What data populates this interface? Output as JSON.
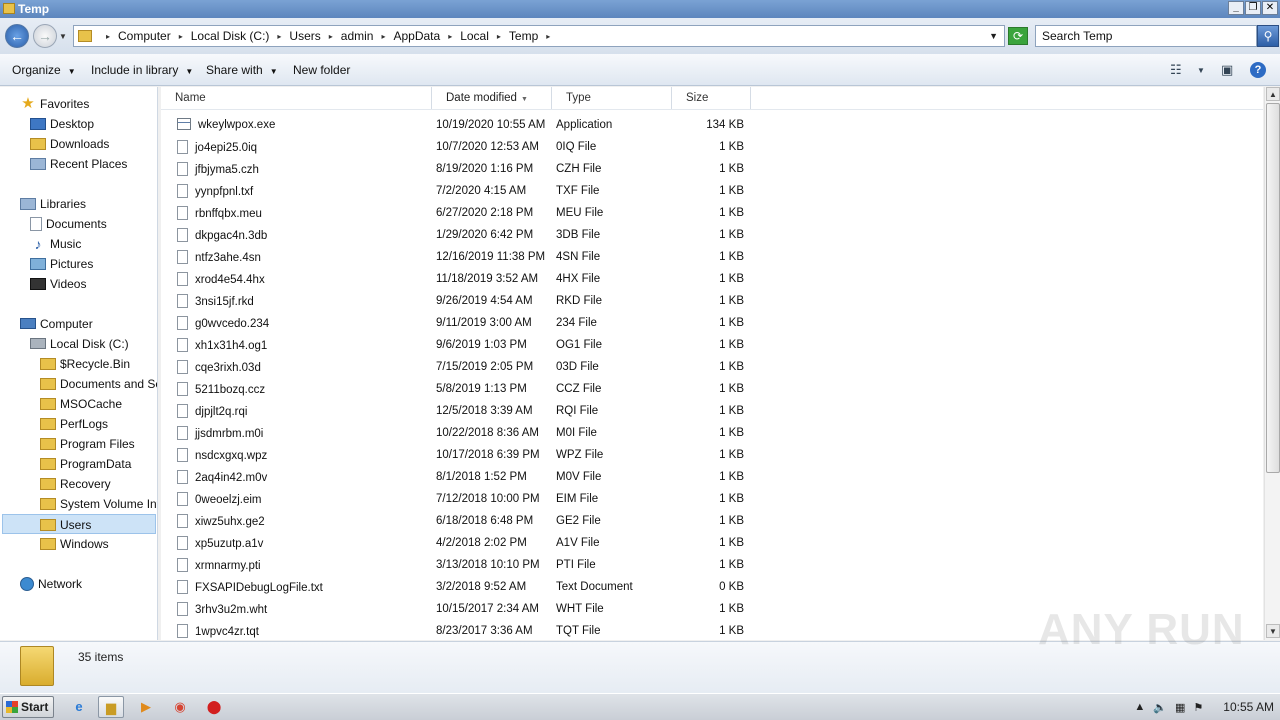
{
  "window": {
    "title": "Temp"
  },
  "address": {
    "crumbs": [
      "Computer",
      "Local Disk (C:)",
      "Users",
      "admin",
      "AppData",
      "Local",
      "Temp"
    ],
    "search_placeholder": "Search Temp"
  },
  "toolbar": {
    "organize": "Organize",
    "include_in_library": "Include in library",
    "share_with": "Share with",
    "new_folder": "New folder"
  },
  "sidebar": {
    "favorites": "Favorites",
    "desktop": "Desktop",
    "downloads": "Downloads",
    "recent_places": "Recent Places",
    "libraries": "Libraries",
    "documents": "Documents",
    "music": "Music",
    "pictures": "Pictures",
    "videos": "Videos",
    "computer": "Computer",
    "local_disk": "Local Disk (C:)",
    "folders": [
      "$Recycle.Bin",
      "Documents and Sett",
      "MSOCache",
      "PerfLogs",
      "Program Files",
      "ProgramData",
      "Recovery",
      "System Volume Infor",
      "Users",
      "Windows"
    ],
    "network": "Network"
  },
  "columns": {
    "name": "Name",
    "date": "Date modified",
    "type": "Type",
    "size": "Size"
  },
  "files": [
    {
      "name": "wkeylwpox.exe",
      "date": "10/19/2020 10:55 AM",
      "type": "Application",
      "size": "134 KB"
    },
    {
      "name": "jo4epi25.0iq",
      "date": "10/7/2020 12:53 AM",
      "type": "0IQ File",
      "size": "1 KB"
    },
    {
      "name": "jfbjyma5.czh",
      "date": "8/19/2020 1:16 PM",
      "type": "CZH File",
      "size": "1 KB"
    },
    {
      "name": "yynpfpnl.txf",
      "date": "7/2/2020 4:15 AM",
      "type": "TXF File",
      "size": "1 KB"
    },
    {
      "name": "rbnffqbx.meu",
      "date": "6/27/2020 2:18 PM",
      "type": "MEU File",
      "size": "1 KB"
    },
    {
      "name": "dkpgac4n.3db",
      "date": "1/29/2020 6:42 PM",
      "type": "3DB File",
      "size": "1 KB"
    },
    {
      "name": "ntfz3ahe.4sn",
      "date": "12/16/2019 11:38 PM",
      "type": "4SN File",
      "size": "1 KB"
    },
    {
      "name": "xrod4e54.4hx",
      "date": "11/18/2019 3:52 AM",
      "type": "4HX File",
      "size": "1 KB"
    },
    {
      "name": "3nsi15jf.rkd",
      "date": "9/26/2019 4:54 AM",
      "type": "RKD File",
      "size": "1 KB"
    },
    {
      "name": "g0wvcedo.234",
      "date": "9/11/2019 3:00 AM",
      "type": "234 File",
      "size": "1 KB"
    },
    {
      "name": "xh1x31h4.og1",
      "date": "9/6/2019 1:03 PM",
      "type": "OG1 File",
      "size": "1 KB"
    },
    {
      "name": "cqe3rixh.03d",
      "date": "7/15/2019 2:05 PM",
      "type": "03D File",
      "size": "1 KB"
    },
    {
      "name": "5211bozq.ccz",
      "date": "5/8/2019 1:13 PM",
      "type": "CCZ File",
      "size": "1 KB"
    },
    {
      "name": "djpjlt2q.rqi",
      "date": "12/5/2018 3:39 AM",
      "type": "RQI File",
      "size": "1 KB"
    },
    {
      "name": "jjsdmrbm.m0i",
      "date": "10/22/2018 8:36 AM",
      "type": "M0I File",
      "size": "1 KB"
    },
    {
      "name": "nsdcxgxq.wpz",
      "date": "10/17/2018 6:39 PM",
      "type": "WPZ File",
      "size": "1 KB"
    },
    {
      "name": "2aq4in42.m0v",
      "date": "8/1/2018 1:52 PM",
      "type": "M0V File",
      "size": "1 KB"
    },
    {
      "name": "0weoelzj.eim",
      "date": "7/12/2018 10:00 PM",
      "type": "EIM File",
      "size": "1 KB"
    },
    {
      "name": "xiwz5uhx.ge2",
      "date": "6/18/2018 6:48 PM",
      "type": "GE2 File",
      "size": "1 KB"
    },
    {
      "name": "xp5uzutp.a1v",
      "date": "4/2/2018 2:02 PM",
      "type": "A1V File",
      "size": "1 KB"
    },
    {
      "name": "xrmnarmy.pti",
      "date": "3/13/2018 10:10 PM",
      "type": "PTI File",
      "size": "1 KB"
    },
    {
      "name": "FXSAPIDebugLogFile.txt",
      "date": "3/2/2018 9:52 AM",
      "type": "Text Document",
      "size": "0 KB"
    },
    {
      "name": "3rhv3u2m.wht",
      "date": "10/15/2017 2:34 AM",
      "type": "WHT File",
      "size": "1 KB"
    },
    {
      "name": "1wpvc4zr.tqt",
      "date": "8/23/2017 3:36 AM",
      "type": "TQT File",
      "size": "1 KB"
    }
  ],
  "status": {
    "item_count": "35 items"
  },
  "taskbar": {
    "start": "Start",
    "clock": "10:55 AM"
  },
  "watermark": "ANY RUN"
}
